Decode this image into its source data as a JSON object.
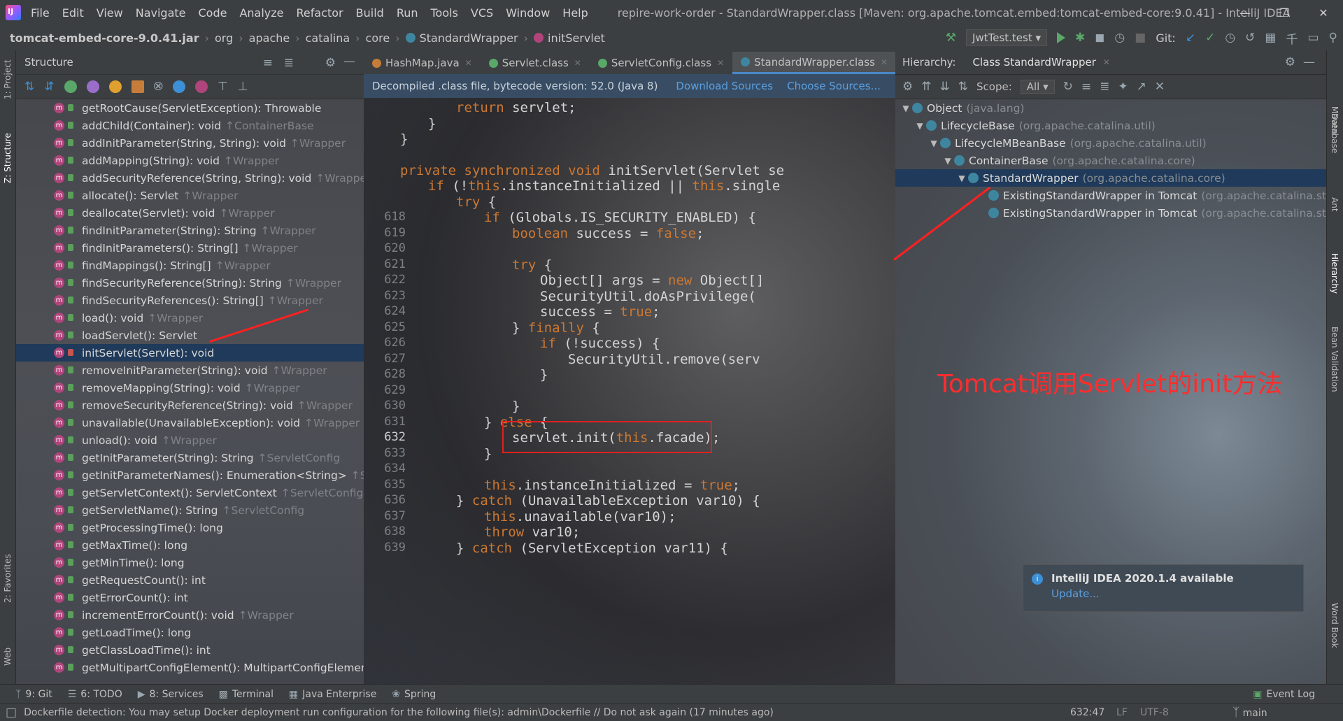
{
  "menubar": {
    "items": [
      "File",
      "Edit",
      "View",
      "Navigate",
      "Code",
      "Analyze",
      "Refactor",
      "Build",
      "Run",
      "Tools",
      "VCS",
      "Window",
      "Help"
    ],
    "title": "repire-work-order - StandardWrapper.class [Maven: org.apache.tomcat.embed:tomcat-embed-core:9.0.41] - IntelliJ IDEA"
  },
  "navbar": {
    "crumbs": [
      "tomcat-embed-core-9.0.41.jar",
      "org",
      "apache",
      "catalina",
      "core",
      "StandardWrapper",
      "initServlet"
    ],
    "run_config": "JwtTest.test",
    "git_label": "Git:"
  },
  "structure": {
    "title": "Structure",
    "items": [
      {
        "label": "getRootCause(ServletException): Throwable",
        "inherit": ""
      },
      {
        "label": "addChild(Container): void",
        "inherit": "↑ContainerBase"
      },
      {
        "label": "addInitParameter(String, String): void",
        "inherit": "↑Wrapper"
      },
      {
        "label": "addMapping(String): void",
        "inherit": "↑Wrapper"
      },
      {
        "label": "addSecurityReference(String, String): void",
        "inherit": "↑Wrapper"
      },
      {
        "label": "allocate(): Servlet",
        "inherit": "↑Wrapper"
      },
      {
        "label": "deallocate(Servlet): void",
        "inherit": "↑Wrapper"
      },
      {
        "label": "findInitParameter(String): String",
        "inherit": "↑Wrapper"
      },
      {
        "label": "findInitParameters(): String[]",
        "inherit": "↑Wrapper"
      },
      {
        "label": "findMappings(): String[]",
        "inherit": "↑Wrapper"
      },
      {
        "label": "findSecurityReference(String): String",
        "inherit": "↑Wrapper"
      },
      {
        "label": "findSecurityReferences(): String[]",
        "inherit": "↑Wrapper"
      },
      {
        "label": "load(): void",
        "inherit": "↑Wrapper"
      },
      {
        "label": "loadServlet(): Servlet",
        "inherit": ""
      },
      {
        "label": "initServlet(Servlet): void",
        "inherit": "",
        "selected": true
      },
      {
        "label": "removeInitParameter(String): void",
        "inherit": "↑Wrapper"
      },
      {
        "label": "removeMapping(String): void",
        "inherit": "↑Wrapper"
      },
      {
        "label": "removeSecurityReference(String): void",
        "inherit": "↑Wrapper"
      },
      {
        "label": "unavailable(UnavailableException): void",
        "inherit": "↑Wrapper"
      },
      {
        "label": "unload(): void",
        "inherit": "↑Wrapper"
      },
      {
        "label": "getInitParameter(String): String",
        "inherit": "↑ServletConfig"
      },
      {
        "label": "getInitParameterNames(): Enumeration<String>",
        "inherit": "↑Servl"
      },
      {
        "label": "getServletContext(): ServletContext",
        "inherit": "↑ServletConfig"
      },
      {
        "label": "getServletName(): String",
        "inherit": "↑ServletConfig"
      },
      {
        "label": "getProcessingTime(): long",
        "inherit": ""
      },
      {
        "label": "getMaxTime(): long",
        "inherit": ""
      },
      {
        "label": "getMinTime(): long",
        "inherit": ""
      },
      {
        "label": "getRequestCount(): int",
        "inherit": ""
      },
      {
        "label": "getErrorCount(): int",
        "inherit": ""
      },
      {
        "label": "incrementErrorCount(): void",
        "inherit": "↑Wrapper"
      },
      {
        "label": "getLoadTime(): long",
        "inherit": ""
      },
      {
        "label": "getClassLoadTime(): int",
        "inherit": ""
      },
      {
        "label": "getMultipartConfigElement(): MultipartConfigElement",
        "inherit": ""
      }
    ]
  },
  "editor": {
    "tabs": [
      {
        "label": "HashMap.java",
        "color": "#c77d3a"
      },
      {
        "label": "Servlet.class",
        "color": "#59a869"
      },
      {
        "label": "ServletConfig.class",
        "color": "#59a869"
      },
      {
        "label": "StandardWrapper.class",
        "color": "#3e86a0",
        "active": true
      }
    ],
    "banner": "Decompiled .class file, bytecode version: 52.0 (Java 8)",
    "download_sources": "Download Sources",
    "choose_sources": "Choose Sources...",
    "line_numbers": [
      "618",
      "619",
      "620",
      "621",
      "622",
      "623",
      "624",
      "625",
      "626",
      "627",
      "628",
      "629",
      "630",
      "631",
      "632",
      "633",
      "634",
      "635",
      "636",
      "637",
      "638",
      "639"
    ],
    "current_line": "632"
  },
  "hierarchy": {
    "label": "Hierarchy:",
    "tab": "Class StandardWrapper",
    "scope_label": "Scope:",
    "scope_value": "All",
    "nodes": [
      {
        "name": "Object",
        "pkg": "(java.lang)"
      },
      {
        "name": "LifecycleBase",
        "pkg": "(org.apache.catalina.util)"
      },
      {
        "name": "LifecycleMBeanBase",
        "pkg": "(org.apache.catalina.util)"
      },
      {
        "name": "ContainerBase",
        "pkg": "(org.apache.catalina.core)"
      },
      {
        "name": "StandardWrapper",
        "pkg": "(org.apache.catalina.core)",
        "selected": true
      },
      {
        "name": "ExistingStandardWrapper in Tomcat",
        "pkg": "(org.apache.catalina.st"
      },
      {
        "name": "ExistingStandardWrapper in Tomcat",
        "pkg": "(org.apache.catalina.st"
      }
    ],
    "annotation": "Tomcat调用Servlet的init方法",
    "notification_title": "IntelliJ IDEA 2020.1.4 available",
    "notification_link": "Update..."
  },
  "left_strip": [
    "1: Project",
    "Z: Structure",
    "2: Favorites",
    "Web"
  ],
  "right_strip": [
    "Maven",
    "Database",
    "Ant",
    "Hierarchy",
    "Bean Validation",
    "Word Book"
  ],
  "toolbar": {
    "items": [
      "9: Git",
      "6: TODO",
      "8: Services",
      "Terminal",
      "Java Enterprise",
      "Spring"
    ],
    "event_log": "Event Log"
  },
  "status": {
    "message": "Dockerfile detection: You may setup Docker deployment run configuration for the following file(s): admin\\Dockerfile // Do not ask again (17 minutes ago)",
    "position": "632:47",
    "line_sep": "LF",
    "encoding": "UTF-8",
    "branch": "main"
  }
}
